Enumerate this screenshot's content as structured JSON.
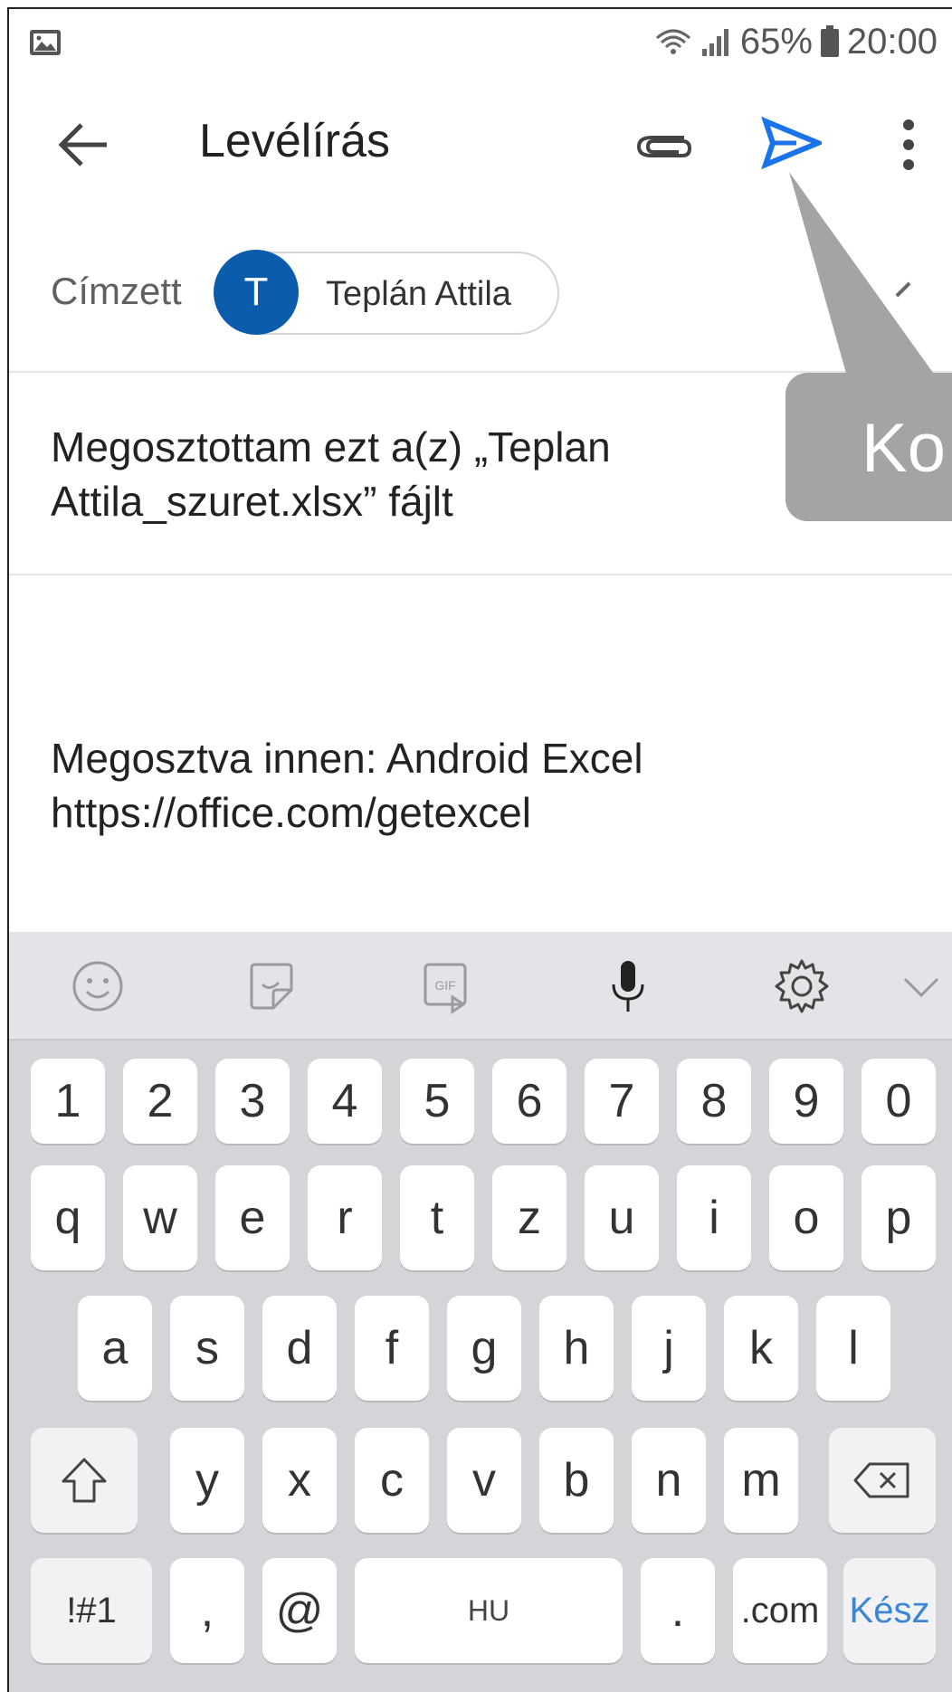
{
  "status_bar": {
    "battery_percent": "65%",
    "time": "20:00",
    "icons": [
      "image-notification-icon",
      "wifi-icon",
      "signal-icon",
      "battery-icon"
    ]
  },
  "app_bar": {
    "title": "Levélírás",
    "icons": [
      "back-arrow-icon",
      "paperclip-icon",
      "send-icon",
      "more-vert-icon"
    ],
    "send_color": "#1a73e8"
  },
  "compose": {
    "to_label": "Címzett",
    "recipient": {
      "initial": "T",
      "name": "Teplán Attila",
      "avatar_color": "#0b5cad"
    },
    "subject_lines": [
      "Megosztottam ezt a(z) „Teplan",
      "Attila_szuret.xlsx” fájlt"
    ],
    "body_lines": [
      "Megosztva innen: Android Excel",
      "https://office.com/getexcel"
    ]
  },
  "callout": {
    "text": "Ko"
  },
  "keyboard": {
    "toolbar_icons": [
      "emoji-icon",
      "sticker-icon",
      "gif-icon",
      "microphone-icon",
      "settings-icon",
      "chevron-down-icon"
    ],
    "row_numbers": [
      "1",
      "2",
      "3",
      "4",
      "5",
      "6",
      "7",
      "8",
      "9",
      "0"
    ],
    "row_q": [
      "q",
      "w",
      "e",
      "r",
      "t",
      "z",
      "u",
      "i",
      "o",
      "p"
    ],
    "row_a": [
      "a",
      "s",
      "d",
      "f",
      "g",
      "h",
      "j",
      "k",
      "l"
    ],
    "row_y": [
      "y",
      "x",
      "c",
      "v",
      "b",
      "n",
      "m"
    ],
    "bottom": {
      "symbols": "!#1",
      "comma": ",",
      "at": "@",
      "space": "HU",
      "period": ".",
      "dotcom": ".com",
      "done": "Kész"
    },
    "done_color": "#3a86d4"
  }
}
